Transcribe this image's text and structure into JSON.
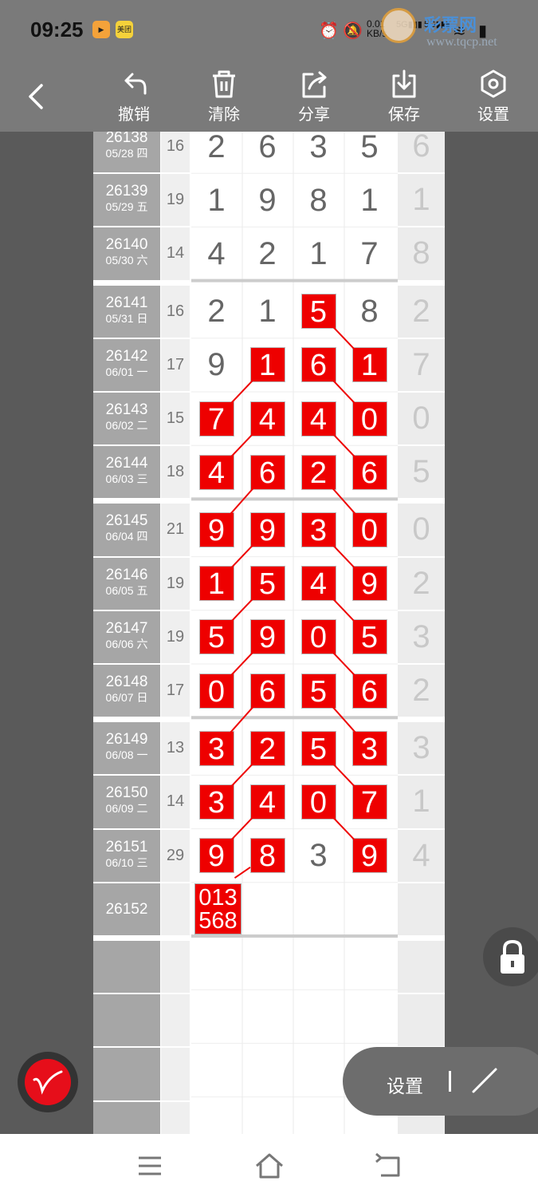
{
  "status": {
    "time": "09:25",
    "app_icon_1": "video-app-icon",
    "app_icon_2": "coupon-app-icon",
    "app_icon_2_text": "美团",
    "network_speed_top": "0.01",
    "network_speed_unit": "KB/s",
    "sim1": "5G",
    "sim2": "5G"
  },
  "watermark": {
    "line1": "彩票网",
    "line2": "www.tqcp.net"
  },
  "toolbar": {
    "back_icon": "back-arrow-icon",
    "items": [
      {
        "label": "撤销",
        "icon": "undo-icon"
      },
      {
        "label": "清除",
        "icon": "trash-icon"
      },
      {
        "label": "分享",
        "icon": "share-icon"
      },
      {
        "label": "保存",
        "icon": "download-icon"
      },
      {
        "label": "设置",
        "icon": "hexagon-settings-icon"
      }
    ]
  },
  "colors": {
    "hit": "#ee0000",
    "issue_bg": "#a6a6a6",
    "header_bg": "#7a7a7a"
  },
  "draws": [
    {
      "issue": "26138",
      "date": "05/28 四",
      "sum": "16",
      "digits": [
        "2",
        "6",
        "3",
        "5"
      ],
      "hits": [
        false,
        false,
        false,
        false
      ],
      "extra": "6"
    },
    {
      "issue": "26139",
      "date": "05/29 五",
      "sum": "19",
      "digits": [
        "1",
        "9",
        "8",
        "1"
      ],
      "hits": [
        false,
        false,
        false,
        false
      ],
      "extra": "1"
    },
    {
      "issue": "26140",
      "date": "05/30 六",
      "sum": "14",
      "digits": [
        "4",
        "2",
        "1",
        "7"
      ],
      "hits": [
        false,
        false,
        false,
        false
      ],
      "extra": "8"
    },
    {
      "issue": "26141",
      "date": "05/31 日",
      "sum": "16",
      "digits": [
        "2",
        "1",
        "5",
        "8"
      ],
      "hits": [
        false,
        false,
        true,
        false
      ],
      "extra": "2"
    },
    {
      "issue": "26142",
      "date": "06/01 一",
      "sum": "17",
      "digits": [
        "9",
        "1",
        "6",
        "1"
      ],
      "hits": [
        false,
        true,
        true,
        true
      ],
      "extra": "7"
    },
    {
      "issue": "26143",
      "date": "06/02 二",
      "sum": "15",
      "digits": [
        "7",
        "4",
        "4",
        "0"
      ],
      "hits": [
        true,
        true,
        true,
        true
      ],
      "extra": "0"
    },
    {
      "issue": "26144",
      "date": "06/03 三",
      "sum": "18",
      "digits": [
        "4",
        "6",
        "2",
        "6"
      ],
      "hits": [
        true,
        true,
        true,
        true
      ],
      "extra": "5"
    },
    {
      "issue": "26145",
      "date": "06/04 四",
      "sum": "21",
      "digits": [
        "9",
        "9",
        "3",
        "0"
      ],
      "hits": [
        true,
        true,
        true,
        true
      ],
      "extra": "0"
    },
    {
      "issue": "26146",
      "date": "06/05 五",
      "sum": "19",
      "digits": [
        "1",
        "5",
        "4",
        "9"
      ],
      "hits": [
        true,
        true,
        true,
        true
      ],
      "extra": "2"
    },
    {
      "issue": "26147",
      "date": "06/06 六",
      "sum": "19",
      "digits": [
        "5",
        "9",
        "0",
        "5"
      ],
      "hits": [
        true,
        true,
        true,
        true
      ],
      "extra": "3"
    },
    {
      "issue": "26148",
      "date": "06/07 日",
      "sum": "17",
      "digits": [
        "0",
        "6",
        "5",
        "6"
      ],
      "hits": [
        true,
        true,
        true,
        true
      ],
      "extra": "2"
    },
    {
      "issue": "26149",
      "date": "06/08 一",
      "sum": "13",
      "digits": [
        "3",
        "2",
        "5",
        "3"
      ],
      "hits": [
        true,
        true,
        true,
        true
      ],
      "extra": "3"
    },
    {
      "issue": "26150",
      "date": "06/09 二",
      "sum": "14",
      "digits": [
        "3",
        "4",
        "0",
        "7"
      ],
      "hits": [
        true,
        true,
        true,
        true
      ],
      "extra": "1"
    },
    {
      "issue": "26151",
      "date": "06/10 三",
      "sum": "29",
      "digits": [
        "9",
        "8",
        "3",
        "9"
      ],
      "hits": [
        true,
        true,
        false,
        true
      ],
      "extra": "4"
    }
  ],
  "prediction": {
    "issue": "26152",
    "line1": "013",
    "line2": "568"
  },
  "floating": {
    "lock_icon": "lock-icon",
    "settings_label": "设置",
    "pen_icon": "line-tool-icon",
    "brush_icon": "brush-icon"
  },
  "nav": {
    "menu": "menu-icon",
    "home": "home-icon",
    "back": "back-icon"
  }
}
